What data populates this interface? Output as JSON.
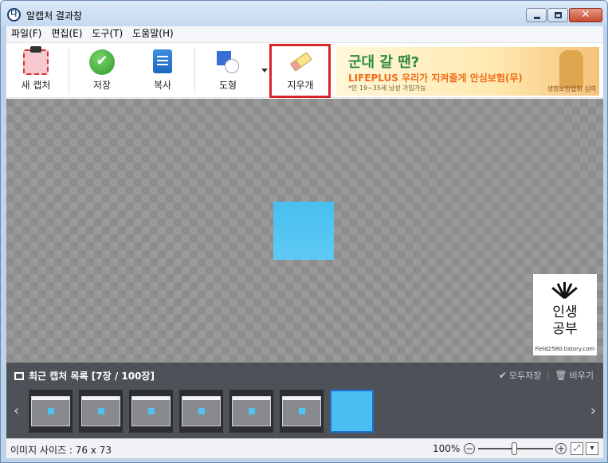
{
  "window": {
    "title": "알캡처 결과창",
    "app_icon_glyph": "다",
    "close_glyph": "✕"
  },
  "menu": [
    {
      "label": "파일(F)"
    },
    {
      "label": "편집(E)"
    },
    {
      "label": "도구(T)"
    },
    {
      "label": "도움말(H)"
    }
  ],
  "toolbar": {
    "new_capture_label": "새 캡처",
    "save_label": "저장",
    "save_glyph": "✔",
    "copy_label": "복사",
    "shape_label": "도형",
    "eraser_label": "지우개"
  },
  "ad": {
    "title": "군대 갈 땐?",
    "subtitle": "LIFEPLUS 우리가 지켜줄게 안심보험(무)",
    "note": "*만 19~35세 남성 가입가능",
    "brand": "생명보험협회 심의"
  },
  "watermark": {
    "line1": "인생",
    "line2": "공부",
    "url": "Field2580.tistory.com"
  },
  "recent": {
    "title": "최근 캡처 목록 [7장 / 100장]",
    "save_all": "모두저장",
    "save_all_glyph": "✔",
    "clear": "비우기",
    "clear_glyph": "🗑",
    "prev_glyph": "‹",
    "next_glyph": "›"
  },
  "status": {
    "image_size": "이미지 사이즈 : 76 x 73",
    "zoom": "100%",
    "zoom_minus_glyph": "−",
    "zoom_plus_glyph": "+",
    "fit_glyph": "⤢",
    "dropdown_glyph": "▾"
  },
  "colors": {
    "accent": "#d8232a",
    "captured_fill": "#4fc3f2",
    "panel_bg": "#4e5157"
  }
}
